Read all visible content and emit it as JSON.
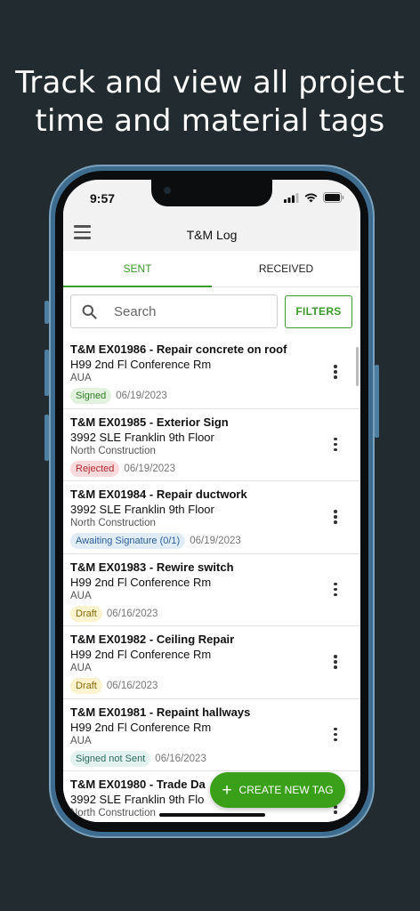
{
  "headline": {
    "line1": "Track and view all project",
    "line2": "time and material tags"
  },
  "status_bar": {
    "time": "9:57"
  },
  "app_bar": {
    "title": "T&M Log"
  },
  "tabs": [
    {
      "label": "SENT",
      "active": true
    },
    {
      "label": "RECEIVED",
      "active": false
    }
  ],
  "search": {
    "placeholder": "Search"
  },
  "filters_label": "FILTERS",
  "colors": {
    "accent": "#3a9a2a",
    "fab": "#3aa019"
  },
  "tags": [
    {
      "title": "T&M EX01986 - Repair concrete on roof",
      "location": "H99 2nd Fl Conference Rm",
      "company": "AUA",
      "status": "Signed",
      "date": "06/19/2023"
    },
    {
      "title": "T&M EX01985 - Exterior Sign",
      "location": "3992 SLE Franklin 9th Floor",
      "company": "North Construction",
      "status": "Rejected",
      "date": "06/19/2023"
    },
    {
      "title": "T&M EX01984 - Repair ductwork",
      "location": "3992 SLE Franklin 9th Floor",
      "company": "North Construction",
      "status": "Awaiting Signature (0/1)",
      "date": "06/19/2023"
    },
    {
      "title": "T&M EX01983 - Rewire switch",
      "location": "H99 2nd Fl Conference Rm",
      "company": "AUA",
      "status": "Draft",
      "date": "06/16/2023"
    },
    {
      "title": "T&M EX01982 - Ceiling Repair",
      "location": "H99 2nd Fl Conference Rm",
      "company": "AUA",
      "status": "Draft",
      "date": "06/16/2023"
    },
    {
      "title": "T&M EX01981 - Repaint hallways",
      "location": "H99 2nd Fl Conference Rm",
      "company": "AUA",
      "status": "Signed not Sent",
      "date": "06/16/2023"
    },
    {
      "title": "T&M EX01980 - Trade Da",
      "location": "3992 SLE Franklin 9th Flo",
      "company": "North Construction",
      "status": "",
      "date": ""
    }
  ],
  "status_styles": {
    "Signed": {
      "bg": "#e3f2df",
      "fg": "#2f7d25"
    },
    "Rejected": {
      "bg": "#fadadd",
      "fg": "#b3262f"
    },
    "Awaiting Signature (0/1)": {
      "bg": "#e1ecf9",
      "fg": "#2b5e9a"
    },
    "Draft": {
      "bg": "#fdf3cf",
      "fg": "#8a6a06"
    },
    "Signed not Sent": {
      "bg": "#e3f2ef",
      "fg": "#2b6b5d"
    }
  },
  "fab": {
    "label": "CREATE NEW TAG",
    "icon": "plus-icon"
  }
}
